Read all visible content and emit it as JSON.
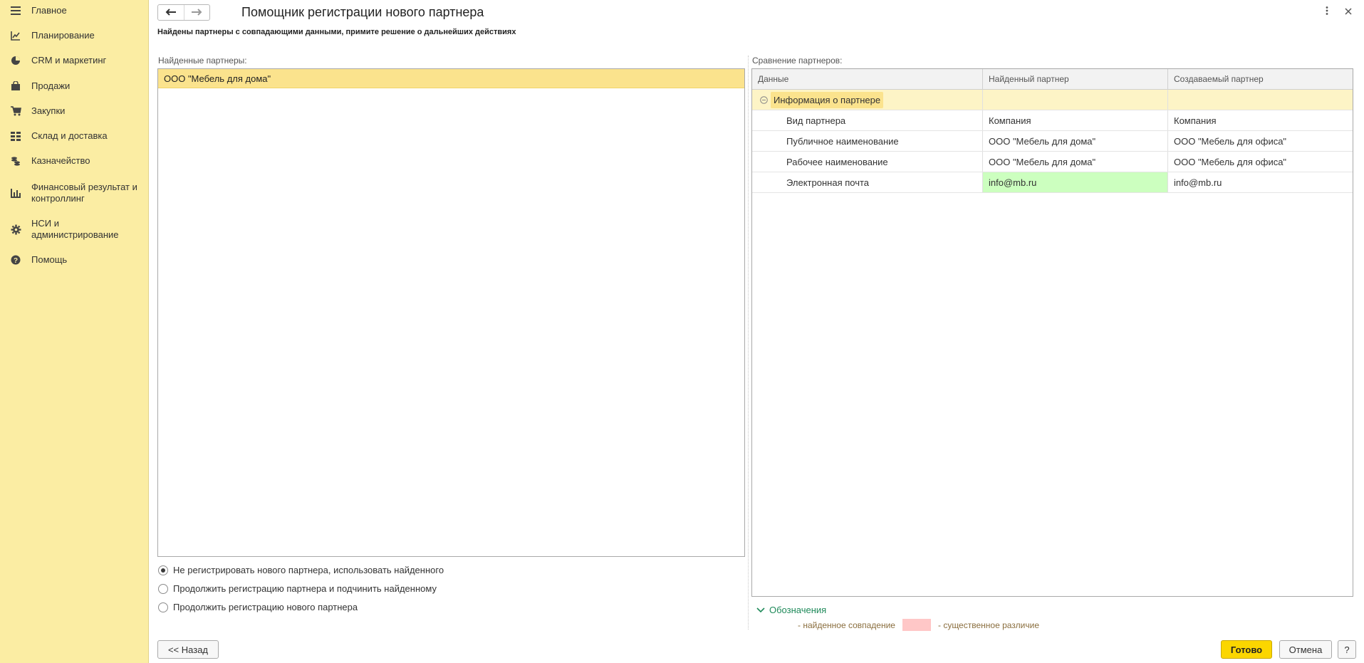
{
  "sidebar": {
    "items": [
      {
        "label": "Главное",
        "icon": "menu-icon"
      },
      {
        "label": "Планирование",
        "icon": "planning-chart-icon"
      },
      {
        "label": "CRM и маркетинг",
        "icon": "pie-chart-icon"
      },
      {
        "label": "Продажи",
        "icon": "shopping-bag-icon"
      },
      {
        "label": "Закупки",
        "icon": "shopping-cart-icon"
      },
      {
        "label": "Склад и доставка",
        "icon": "warehouse-grid-icon"
      },
      {
        "label": "Казначейство",
        "icon": "coins-icon"
      },
      {
        "label": "Финансовый результат и контроллинг",
        "icon": "bar-chart-icon"
      },
      {
        "label": "НСИ и администрирование",
        "icon": "gear-icon"
      },
      {
        "label": "Помощь",
        "icon": "question-icon"
      }
    ]
  },
  "header": {
    "title": "Помощник регистрации нового партнера",
    "subtitle": "Найдены партнеры с совпадающими данными, примите решение о дальнейших действиях"
  },
  "found": {
    "label": "Найденные партнеры:",
    "items": [
      "ООО \"Мебель для дома\""
    ]
  },
  "options": [
    {
      "label": "Не регистрировать нового партнера, использовать найденного",
      "checked": true
    },
    {
      "label": "Продолжить регистрацию партнера и подчинить найденному",
      "checked": false
    },
    {
      "label": "Продолжить регистрацию нового партнера",
      "checked": false
    }
  ],
  "compare": {
    "label": "Сравнение партнеров:",
    "columns": [
      "Данные",
      "Найденный партнер",
      "Создаваемый партнер"
    ],
    "group": "Информация о партнере",
    "rows": [
      {
        "field": "Вид партнера",
        "found": "Компания",
        "created": "Компания",
        "match": false
      },
      {
        "field": "Публичное наименование",
        "found": "ООО \"Мебель для дома\"",
        "created": "ООО \"Мебель для офиса\"",
        "match": false
      },
      {
        "field": "Рабочее наименование",
        "found": "ООО \"Мебель для дома\"",
        "created": "ООО \"Мебель для офиса\"",
        "match": false
      },
      {
        "field": "Электронная почта",
        "found": "info@mb.ru",
        "created": "info@mb.ru",
        "match": true
      }
    ]
  },
  "legend": {
    "title": "Обозначения",
    "match_text": "- найденное совпадение",
    "diff_text": "- существенное различие",
    "match_color": "#ccffbf",
    "diff_color": "#ffc7c7"
  },
  "footer": {
    "back": "<< Назад",
    "done": "Готово",
    "cancel": "Отмена",
    "help": "?"
  }
}
